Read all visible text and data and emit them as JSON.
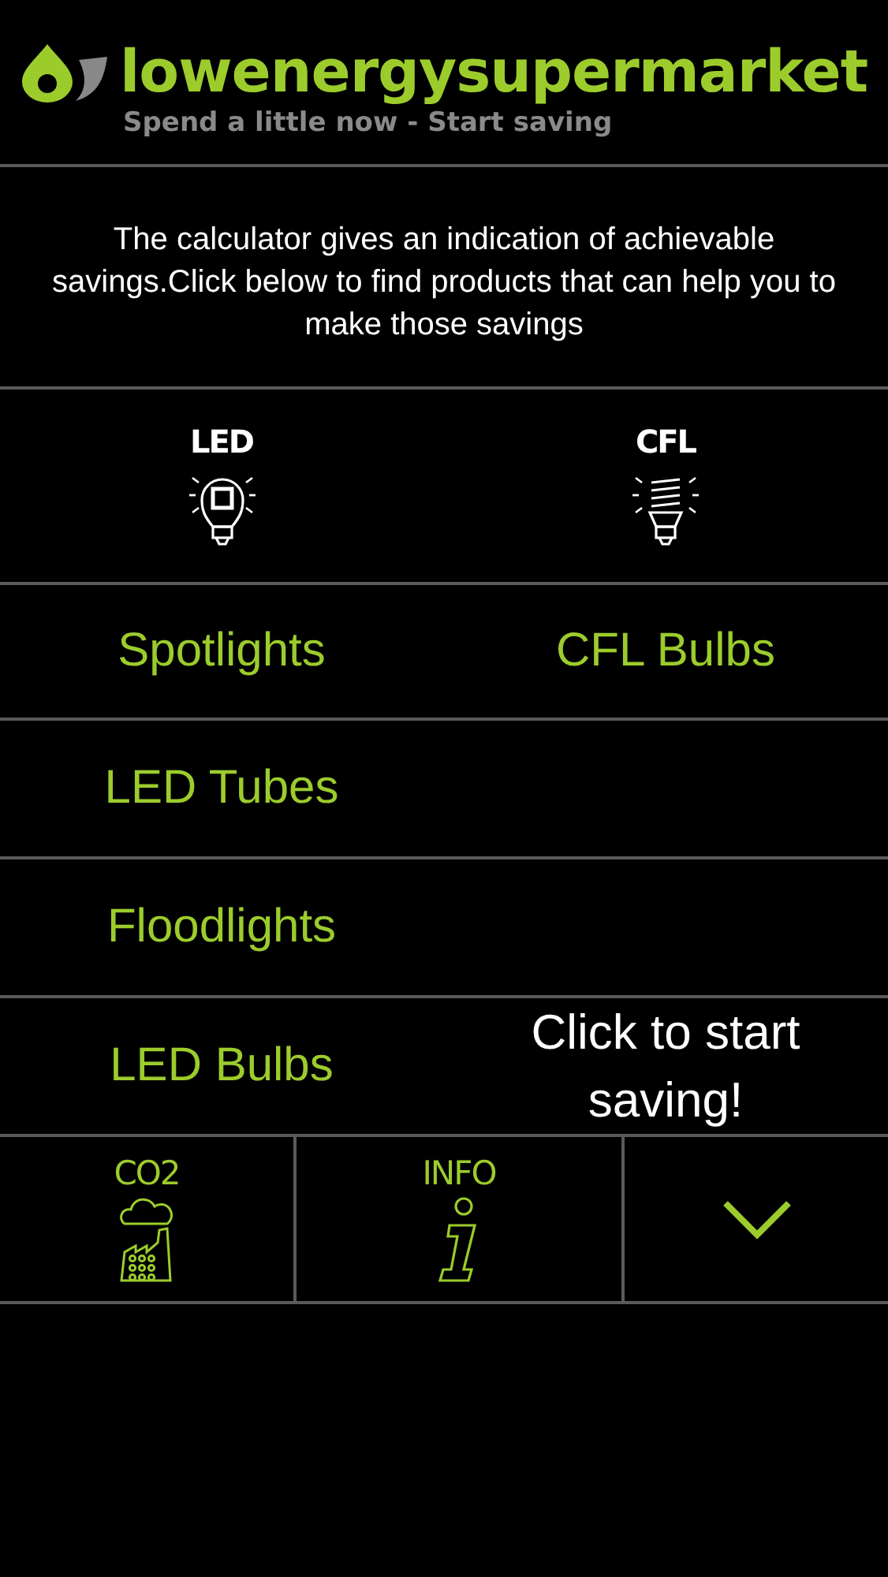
{
  "header": {
    "brand": "lowenergysupermarket",
    "tagline": "Spend a little now - Start saving"
  },
  "intro": "The calculator gives an indication of achievable savings.Click below to find products that can help you to make those savings",
  "categories": [
    {
      "label": "LED",
      "kind": "led"
    },
    {
      "label": "CFL",
      "kind": "cfl"
    }
  ],
  "rows": [
    {
      "left": {
        "kind": "product",
        "label": "Spotlights"
      },
      "right": {
        "kind": "product",
        "label": "CFL Bulbs"
      }
    },
    {
      "left": {
        "kind": "product",
        "label": "LED Tubes"
      },
      "right": {
        "kind": "empty"
      }
    },
    {
      "left": {
        "kind": "product",
        "label": "Floodlights"
      },
      "right": {
        "kind": "empty"
      }
    },
    {
      "left": {
        "kind": "product",
        "label": "LED Bulbs"
      },
      "right": {
        "kind": "cta",
        "label": "Click to start saving!"
      }
    }
  ],
  "nav": [
    {
      "kind": "co2",
      "label": "CO2"
    },
    {
      "kind": "info",
      "label": "INFO"
    },
    {
      "kind": "more"
    }
  ]
}
